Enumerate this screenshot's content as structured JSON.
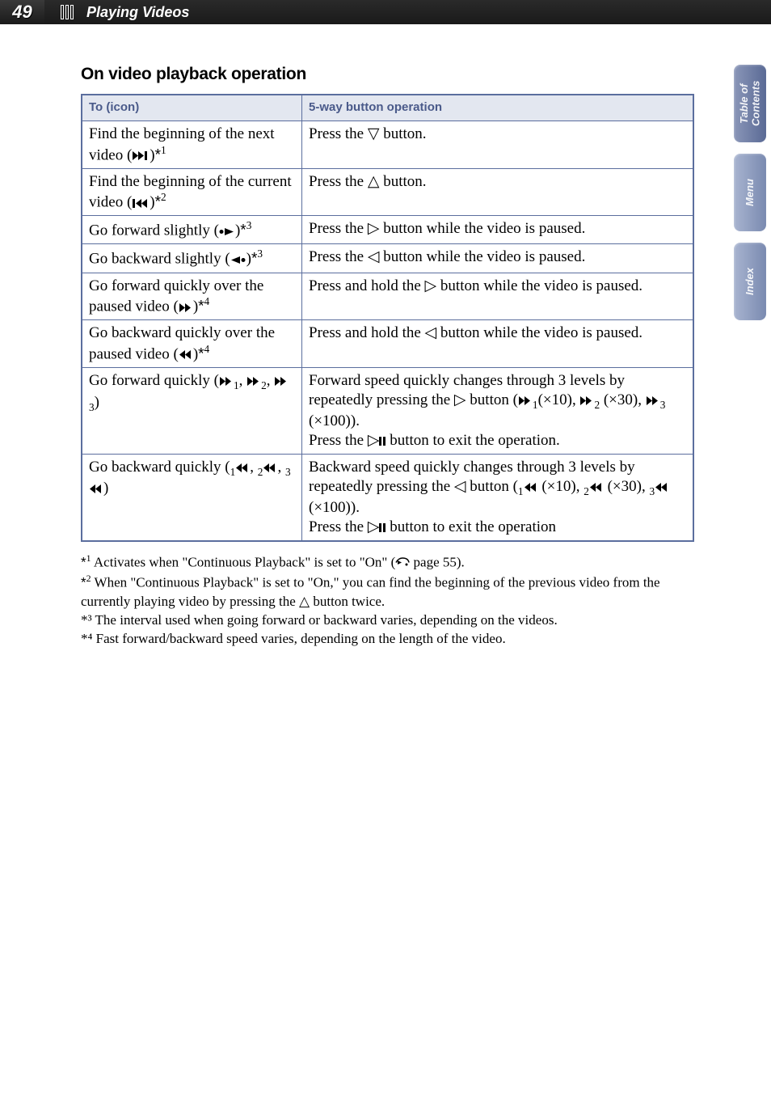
{
  "header": {
    "page_number": "49",
    "section": "Playing Videos"
  },
  "subheading": "On video playback operation",
  "table": {
    "headers": [
      "To (icon)",
      "5-way button operation"
    ],
    "rows": [
      {
        "to": "Find the beginning of the next video (▶▶|)*¹",
        "op": "Press the ▽ button."
      },
      {
        "to": "Find the beginning of the current video (|◀◀)*²",
        "op": "Press the △ button."
      },
      {
        "to": "Go forward slightly (•➔)*³",
        "op": "Press the ▷ button while the video is paused."
      },
      {
        "to": "Go backward slightly (←•)*³",
        "op": "Press the ◁ button while the video is paused."
      },
      {
        "to": "Go forward quickly over the paused video (▶▶)*⁴",
        "op": "Press and hold the ▷ button while the video is paused."
      },
      {
        "to": "Go backward quickly over the paused video (◀◀)*⁴",
        "op": "Press and hold the ◁ button while the video is paused."
      },
      {
        "to": "Go forward quickly (▶▶₁, ▶▶₂, ▶▶₃)",
        "op": "Forward speed quickly changes through 3 levels by repeatedly pressing the ▷ button (▶▶₁(×10), ▶▶₂ (×30), ▶▶₃ (×100)). Press the ▷∥ button to exit the operation."
      },
      {
        "to": "Go backward quickly (₁◀◀, ₂◀◀, ₃◀◀)",
        "op": "Backward speed quickly changes through 3 levels by repeatedly pressing the ◁ button (₁◀◀ (×10), ₂◀◀ (×30), ₃◀◀ (×100)). Press the ▷∥ button to exit the operation"
      }
    ]
  },
  "footnotes": [
    "*¹ Activates when \"Continuous Playback\" is set to \"On\" (☞ page 55).",
    "*² When \"Continuous Playback\" is set to \"On,\" you can find the beginning of the previous video from the currently playing video by pressing the △ button twice.",
    "*³ The interval used when going forward or backward varies, depending on the videos.",
    "*⁴ Fast forward/backward speed varies, depending on the length of the video."
  ],
  "tabs": {
    "toc": "Table of Contents",
    "menu": "Menu",
    "index": "Index"
  }
}
